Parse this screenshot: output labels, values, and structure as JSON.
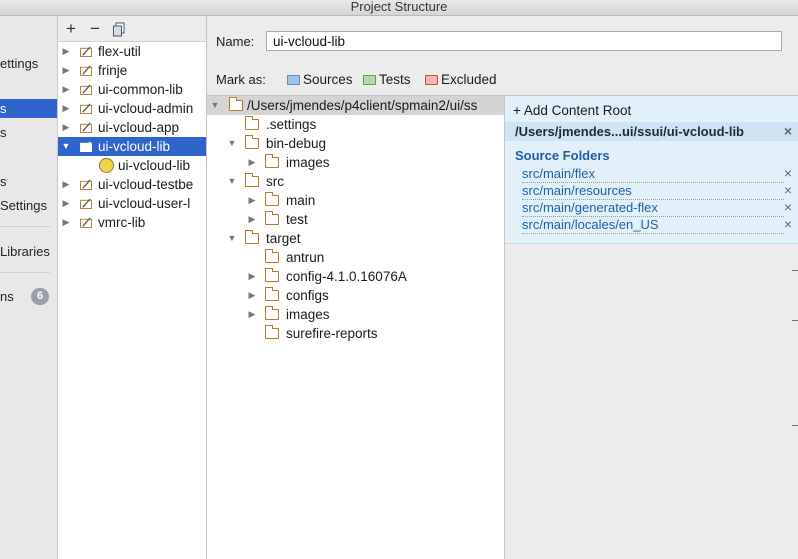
{
  "window": {
    "title": "Project Structure"
  },
  "sidebar": {
    "items": [
      {
        "label": "ettings"
      },
      {
        "label": "s"
      },
      {
        "label": "s"
      },
      {
        "label": "s"
      },
      {
        "label": "Settings"
      },
      {
        "label": "Libraries"
      },
      {
        "label": "ns",
        "badge": "6"
      }
    ],
    "selected_index": 1
  },
  "modules": {
    "toolbar": {
      "add": "+",
      "remove": "−",
      "copy_icon": "copy-icon"
    },
    "items": [
      {
        "label": "flex-util",
        "expanded": false
      },
      {
        "label": "frinje",
        "expanded": false
      },
      {
        "label": "ui-common-lib",
        "expanded": false
      },
      {
        "label": "ui-vcloud-admin",
        "expanded": false
      },
      {
        "label": "ui-vcloud-app",
        "expanded": false
      },
      {
        "label": "ui-vcloud-lib",
        "expanded": true,
        "selected": true
      },
      {
        "label": "ui-vcloud-lib",
        "child": true
      },
      {
        "label": "ui-vcloud-testbe",
        "expanded": false
      },
      {
        "label": "ui-vcloud-user-l",
        "expanded": false
      },
      {
        "label": "vmrc-lib",
        "expanded": false
      }
    ]
  },
  "form": {
    "name_label": "Name:",
    "name_value": "ui-vcloud-lib",
    "mark_as_label": "Mark as:",
    "mark_buttons": [
      {
        "label": "Sources",
        "color": "#6fa8dc"
      },
      {
        "label": "Tests",
        "color": "#6ab04c"
      },
      {
        "label": "Excluded",
        "color": "#e06666"
      }
    ]
  },
  "tree": {
    "root": "/Users/jmendes/p4client/spmain2/ui/ss",
    "nodes": [
      {
        "label": ".settings",
        "level": 1,
        "arrow": "none"
      },
      {
        "label": "bin-debug",
        "level": 1,
        "arrow": "open"
      },
      {
        "label": "images",
        "level": 2,
        "arrow": "closed"
      },
      {
        "label": "src",
        "level": 1,
        "arrow": "open"
      },
      {
        "label": "main",
        "level": 2,
        "arrow": "closed"
      },
      {
        "label": "test",
        "level": 2,
        "arrow": "closed"
      },
      {
        "label": "target",
        "level": 1,
        "arrow": "open"
      },
      {
        "label": "antrun",
        "level": 2,
        "arrow": "none"
      },
      {
        "label": "config-4.1.0.16076A",
        "level": 2,
        "arrow": "closed"
      },
      {
        "label": "configs",
        "level": 2,
        "arrow": "closed"
      },
      {
        "label": "images",
        "level": 2,
        "arrow": "closed"
      },
      {
        "label": "surefire-reports",
        "level": 2,
        "arrow": "none"
      }
    ]
  },
  "content_root": {
    "add_label": "+ Add Content Root",
    "path": "/Users/jmendes...ui/ssui/ui-vcloud-lib",
    "source_folders_title": "Source Folders",
    "source_folders": [
      "src/main/flex",
      "src/main/resources",
      "src/main/generated-flex",
      "src/main/locales/en_US"
    ],
    "remove_glyph": "×"
  },
  "colors": {
    "selection": "#2f65ca",
    "folder": "#b07a2c",
    "source_text": "#1e5fa8",
    "content_root_bg": "#e2f0fa"
  }
}
